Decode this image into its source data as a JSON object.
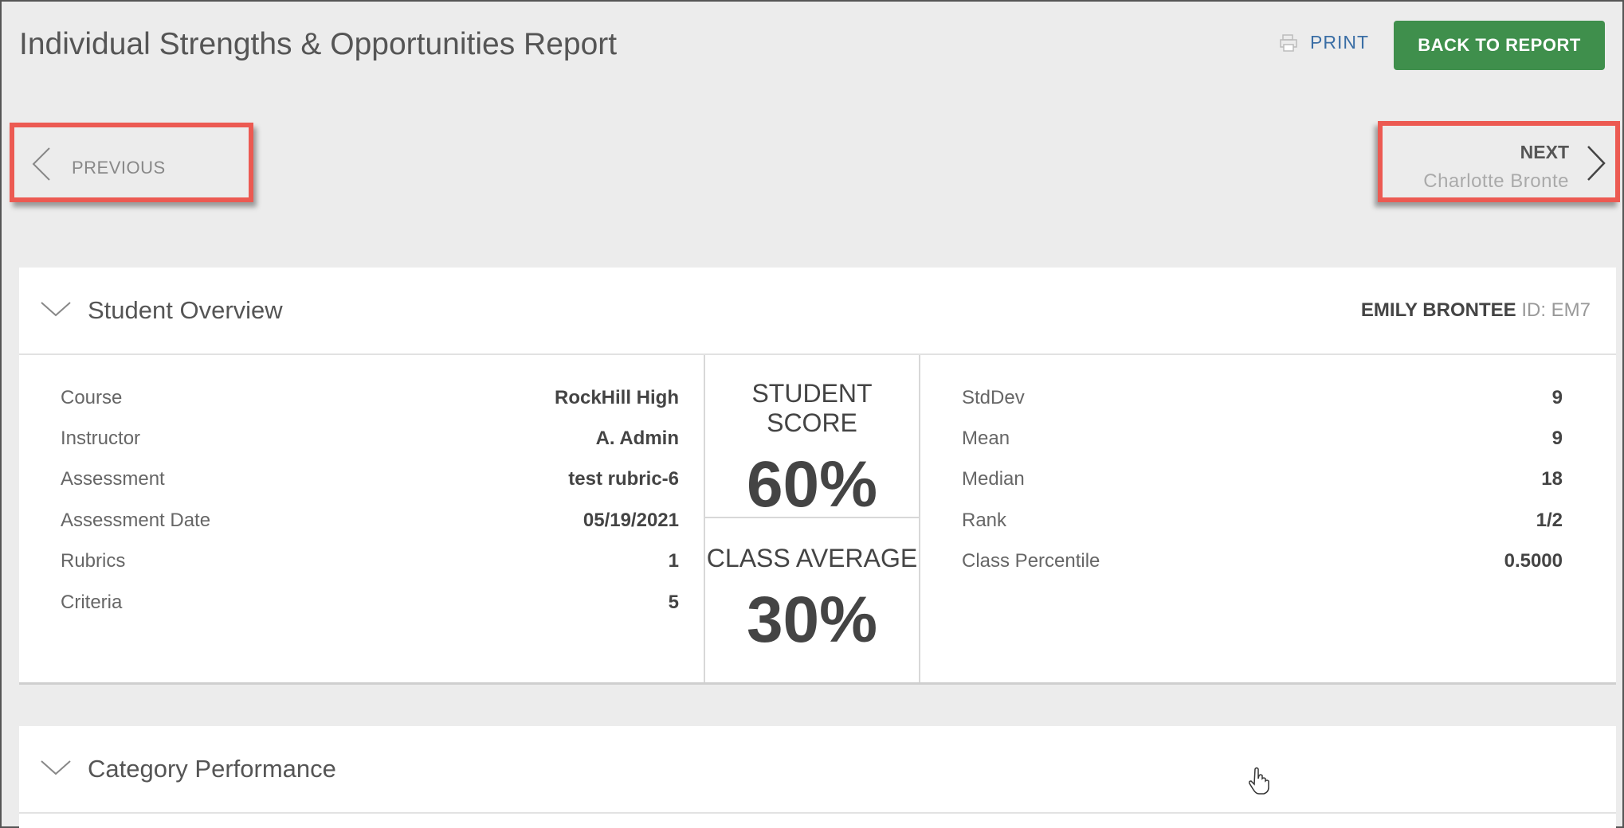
{
  "header": {
    "title": "Individual Strengths & Opportunities Report",
    "print_label": "PRINT",
    "back_label": "BACK TO REPORT"
  },
  "nav": {
    "previous_label": "PREVIOUS",
    "next_label": "NEXT",
    "next_student": "Charlotte Bronte"
  },
  "overview": {
    "title": "Student Overview",
    "student_name": "EMILY BRONTEE",
    "student_id": "ID: EM7",
    "details": [
      {
        "label": "Course",
        "value": "RockHill High"
      },
      {
        "label": "Instructor",
        "value": "A. Admin"
      },
      {
        "label": "Assessment",
        "value": "test rubric-6"
      },
      {
        "label": "Assessment Date",
        "value": "05/19/2021"
      },
      {
        "label": "Rubrics",
        "value": "1"
      },
      {
        "label": "Criteria",
        "value": "5"
      }
    ],
    "student_score_label": "STUDENT SCORE",
    "student_score": "60%",
    "class_average_label": "CLASS AVERAGE",
    "class_average": "30%",
    "stats": [
      {
        "label": "StdDev",
        "value": "9"
      },
      {
        "label": "Mean",
        "value": "9"
      },
      {
        "label": "Median",
        "value": "18"
      },
      {
        "label": "Rank",
        "value": "1/2"
      },
      {
        "label": "Class Percentile",
        "value": "0.5000"
      }
    ]
  },
  "category": {
    "title": "Category Performance"
  },
  "colors": {
    "accent_green": "#3f8f4c",
    "highlight_red": "#ec5a52",
    "link_blue": "#3a6ea5"
  }
}
